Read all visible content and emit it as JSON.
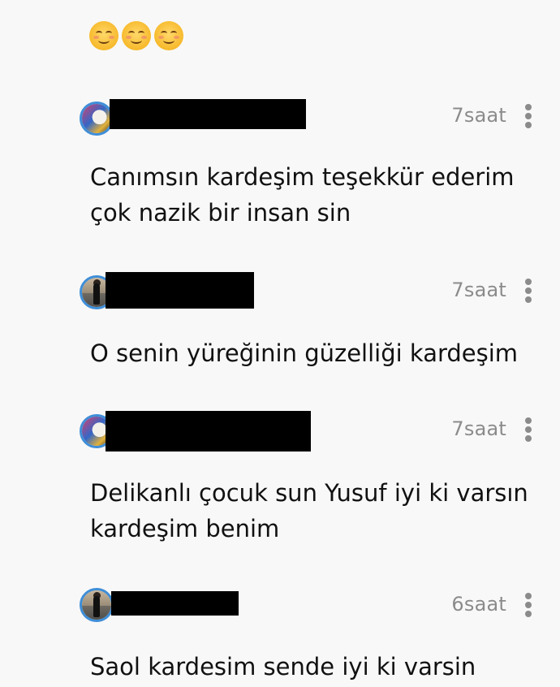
{
  "header": {
    "emojis": [
      "smiling-face-icon",
      "smiling-face-icon",
      "smiling-face-icon"
    ]
  },
  "comments": [
    {
      "avatar": "avatar-art",
      "time": "7saat",
      "text_lines": [
        "Canımsın kardeşim teşekkür ederim",
        "çok nazik bir insan sin"
      ]
    },
    {
      "avatar": "avatar-person",
      "time": "7saat",
      "text_lines": [
        "O senin yüreğinin güzelliği kardeşim"
      ]
    },
    {
      "avatar": "avatar-art",
      "time": "7saat",
      "text_lines": [
        "Delikanlı çocuk sun Yusuf iyi ki varsın",
        "kardeşim benim"
      ]
    },
    {
      "avatar": "avatar-person",
      "time": "6saat",
      "text_lines": [
        "Saol kardesim sende iyi ki varsin"
      ]
    }
  ],
  "colors": {
    "background": "#f8f8f8",
    "text": "#111111",
    "muted": "#8b8b8b",
    "avatar_ring": "#3f8ed8",
    "redaction": "#000000"
  }
}
